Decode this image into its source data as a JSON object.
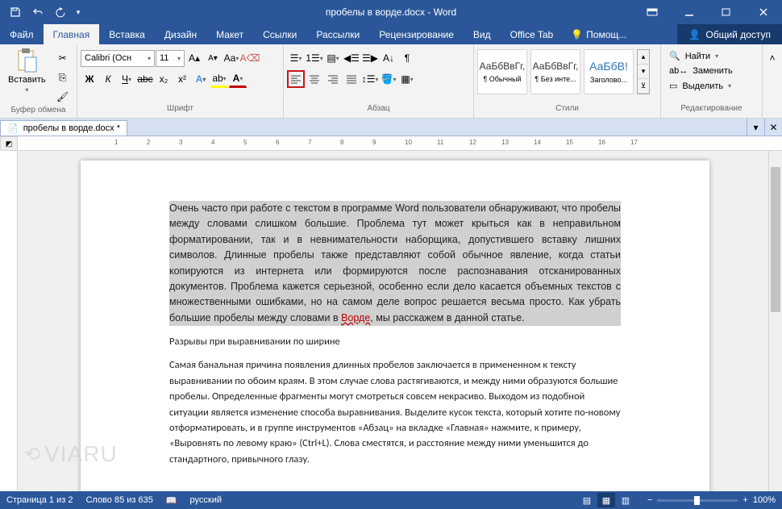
{
  "title": "пробелы в ворде.docx - Word",
  "tabs": {
    "file": "Файл",
    "home": "Главная",
    "insert": "Вставка",
    "design": "Дизайн",
    "layout": "Макет",
    "references": "Ссылки",
    "mailings": "Рассылки",
    "review": "Рецензирование",
    "view": "Вид",
    "officetab": "Office Tab",
    "help": "Помощ...",
    "share": "Общий доступ"
  },
  "ribbon": {
    "clipboard": {
      "label": "Буфер обмена",
      "paste": "Вставить"
    },
    "font": {
      "label": "Шрифт",
      "name": "Calibri (Осн",
      "size": "11"
    },
    "paragraph": {
      "label": "Абзац"
    },
    "styles": {
      "label": "Стили",
      "preview": "АаБбВвГг,",
      "preview_h": "АаБбВ!",
      "s1": "¶ Обычный",
      "s2": "¶ Без инте...",
      "s3": "Заголово..."
    },
    "editing": {
      "label": "Редактирование",
      "find": "Найти",
      "replace": "Заменить",
      "select": "Выделить"
    }
  },
  "doc_tab": {
    "name": "пробелы в ворде.docx *"
  },
  "annotation": "Выравнивание по левому краю",
  "document": {
    "p1": "Очень часто при работе с текстом в программе Word пользователи обнаруживают, что пробелы между словами слишком большие. Проблема тут может крыться как в неправильном форматировании, так и в невнимательности наборщика, допустившего вставку лишних символов. Длинные пробелы также представляют собой обычное явление, когда статьи копируются из интернета или формируются после распознавания отсканированных документов. Проблема кажется серьезной, особенно если дело касается объемных текстов с множественными ошибками, но на самом деле вопрос решается весьма просто. Как убрать большие пробелы между словами в ",
    "p1_link": "Ворде",
    "p1_end": ", мы расскажем в данной статье.",
    "p2": "Разрывы при выравнивании по ширине",
    "p3": "Самая банальная причина появления длинных пробелов заключается в примененном к тексту выравнивании по обоим краям. В этом случае слова растягиваются, и между ними образуются большие пробелы. Определенные фрагменты могут смотреться совсем некрасиво. Выходом из подобной ситуации является изменение способа выравнивания. Выделите кусок текста, который хотите по-новому отформатировать, и в группе инструментов «Абзац» на вкладке «Главная» нажмите, к примеру, «Выровнять по левому краю» (Ctrl+L). Слова сместятся, и расстояние между ними уменьшится до стандартного, привычного глазу."
  },
  "status": {
    "page": "Страница 1 из 2",
    "words": "Слово 85 из 635",
    "lang": "русский",
    "zoom": "100%"
  },
  "watermark": "VIARU"
}
